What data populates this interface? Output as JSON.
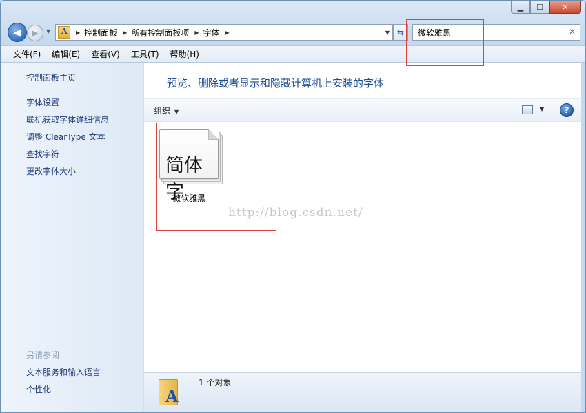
{
  "window": {
    "caption": {
      "minimize": "▁",
      "maximize": "☐",
      "close": "✕"
    }
  },
  "address_bar": {
    "breadcrumbs": [
      "控制面板",
      "所有控制面板项",
      "字体"
    ]
  },
  "search": {
    "value": "微软雅黑",
    "clear": "✕"
  },
  "menubar": {
    "items": [
      "文件(F)",
      "编辑(E)",
      "查看(V)",
      "工具(T)",
      "帮助(H)"
    ]
  },
  "sidebar": {
    "home": "控制面板主页",
    "links": [
      "字体设置",
      "联机获取字体详细信息",
      "调整 ClearType 文本",
      "查找字符",
      "更改字体大小"
    ],
    "see_also_heading": "另请参阅",
    "see_also": [
      "文本服务和输入语言",
      "个性化"
    ]
  },
  "main": {
    "heading": "预览、删除或者显示和隐藏计算机上安装的字体",
    "toolbar": {
      "organize": "组织",
      "help": "?"
    },
    "font_item": {
      "sample": "简体字",
      "name": "微软雅黑"
    },
    "watermark": "http://blog.csdn.net/"
  },
  "details": {
    "count": "1 个对象"
  },
  "colors": {
    "accent": "#1e4e96",
    "highlight_box": "#e0413c"
  }
}
